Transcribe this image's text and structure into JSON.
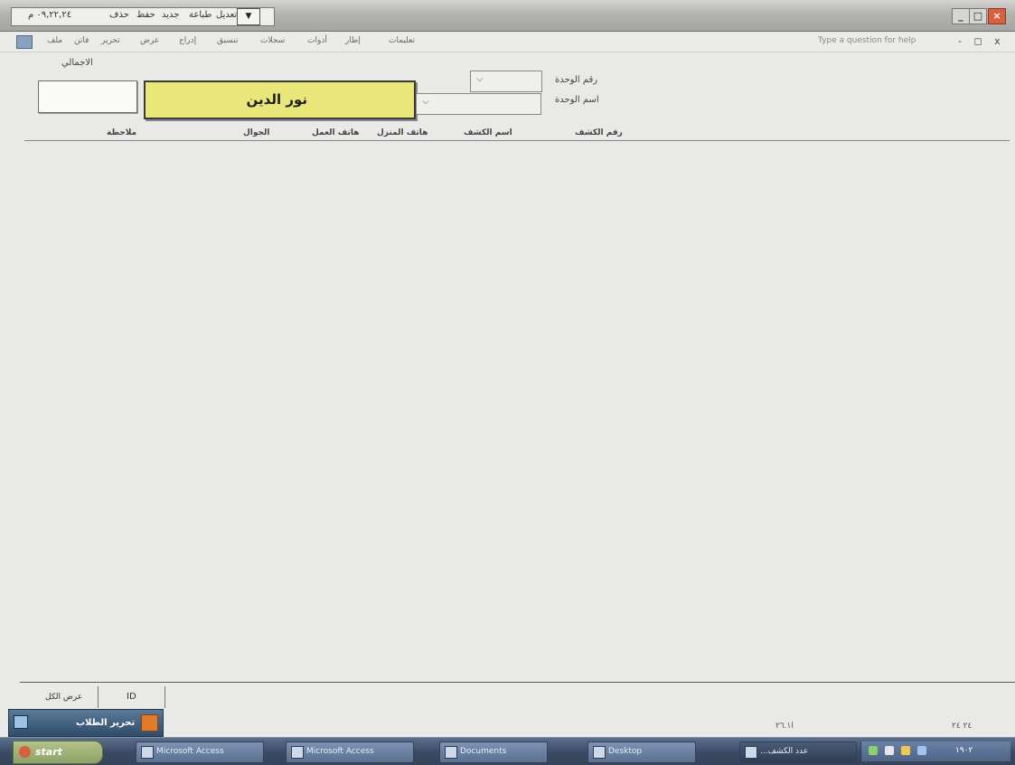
{
  "titlebar": {
    "qat_value": "٠٩,٢٢,٢٤ م",
    "qat_items": [
      "حذف",
      "حفظ",
      "جديد",
      "طباعة",
      "تعديل"
    ]
  },
  "menu": {
    "items": [
      "ملف",
      "فاتن",
      "تحرير",
      "عرض",
      "إدراج",
      "تنسيق",
      "سجلات",
      "أدوات",
      "إطار",
      "تعليمات"
    ],
    "help_placeholder": "Type a question for help",
    "mdi_controls": "- ◻ x"
  },
  "form": {
    "total_label": "الاجمالي",
    "name_value": "نور الدين",
    "unit_id_label": "رقم الوحدة",
    "unit_name_label": "اسم الوحدة",
    "columns": [
      "رقم الكشف",
      "اسم الكشف",
      "هاتف المنزل",
      "هاتف العمل",
      "الجوال",
      "ملاحظة"
    ]
  },
  "status": {
    "view_label": "عرض الكل",
    "record_nav": "ID",
    "panel_title": "تحرير الطلاب",
    "left_text": "ا٢٦.١",
    "right_text": "٢٤ ٢٤"
  },
  "taskbar": {
    "start_label": "start",
    "tasks": [
      "Microsoft Access",
      "Microsoft Access",
      "Documents",
      "Desktop",
      "...عدد الكشف"
    ],
    "clock": "١٩٠٢"
  },
  "colors": {
    "name_box": "#e9e77a",
    "close_button": "#d8603c",
    "taskbar": "#3b4a63"
  }
}
